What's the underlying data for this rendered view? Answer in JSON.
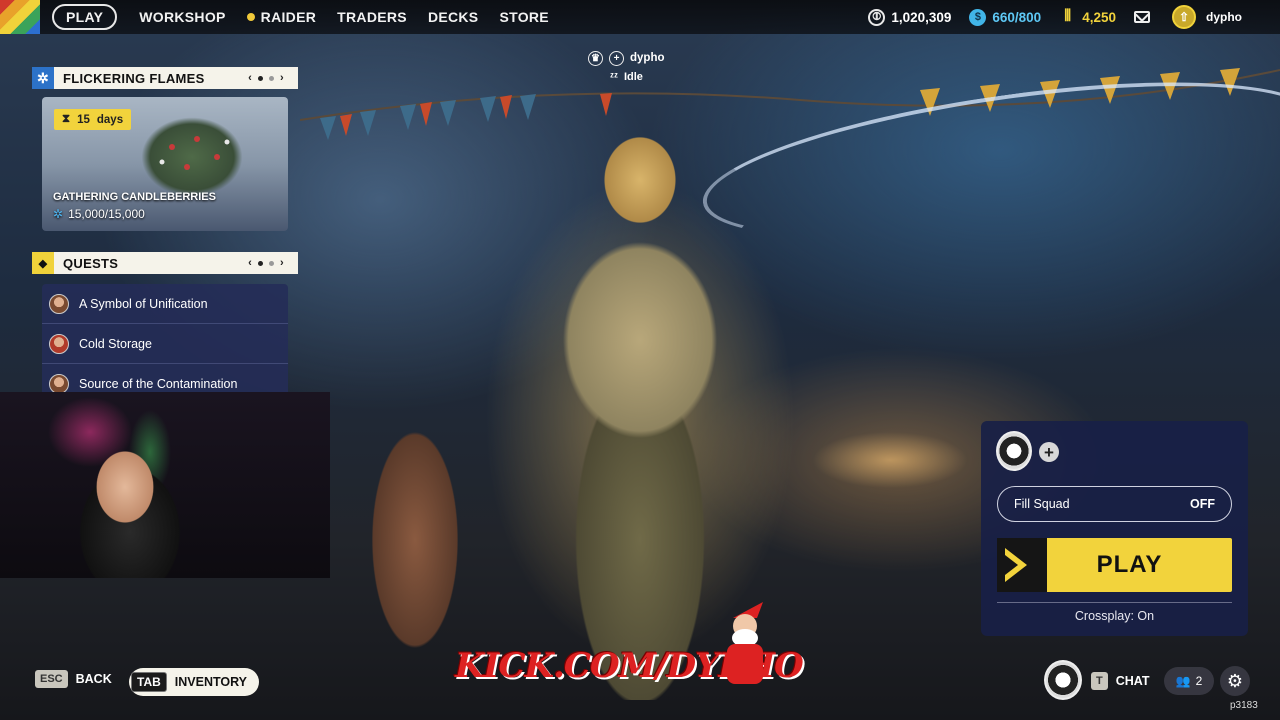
{
  "nav": {
    "items": [
      {
        "label": "PLAY",
        "active": true
      },
      {
        "label": "WORKSHOP"
      },
      {
        "label": "RAIDER"
      },
      {
        "label": "TRADERS"
      },
      {
        "label": "DECKS"
      },
      {
        "label": "STORE"
      }
    ]
  },
  "currency": {
    "coins": "1,020,309",
    "credits": "660/800",
    "raider_tokens": "4,250"
  },
  "profile": {
    "username": "dypho"
  },
  "event": {
    "header": "FLICKERING FLAMES",
    "days_count": "15",
    "days_unit": "days",
    "title": "GATHERING CANDLEBERRIES",
    "progress": "15,000/15,000"
  },
  "quests": {
    "header": "QUESTS",
    "items": [
      {
        "label": "A Symbol of Unification"
      },
      {
        "label": "Cold Storage"
      },
      {
        "label": "Source of the Contamination"
      }
    ]
  },
  "player_tag": {
    "name": "dypho",
    "status": "Idle"
  },
  "squad": {
    "fill_label": "Fill Squad",
    "fill_state": "OFF",
    "play_label": "PLAY",
    "crossplay": "Crossplay: On"
  },
  "footer": {
    "back_key": "ESC",
    "back_label": "BACK",
    "inventory_key": "TAB",
    "inventory_label": "INVENTORY",
    "chat_key": "T",
    "chat_label": "CHAT",
    "friends_count": "2",
    "build_id": "p3183"
  },
  "watermark": "KICK.COM/DYPHO",
  "icons": {
    "coin": "coin-icon",
    "credits": "credits-icon",
    "raider": "raider-token-icon",
    "mail": "mail-icon",
    "settings": "gear-icon"
  },
  "colors": {
    "accent_yellow": "#f2d33c",
    "panel_navy": "#242c58",
    "credit_blue": "#5ec8f5"
  }
}
